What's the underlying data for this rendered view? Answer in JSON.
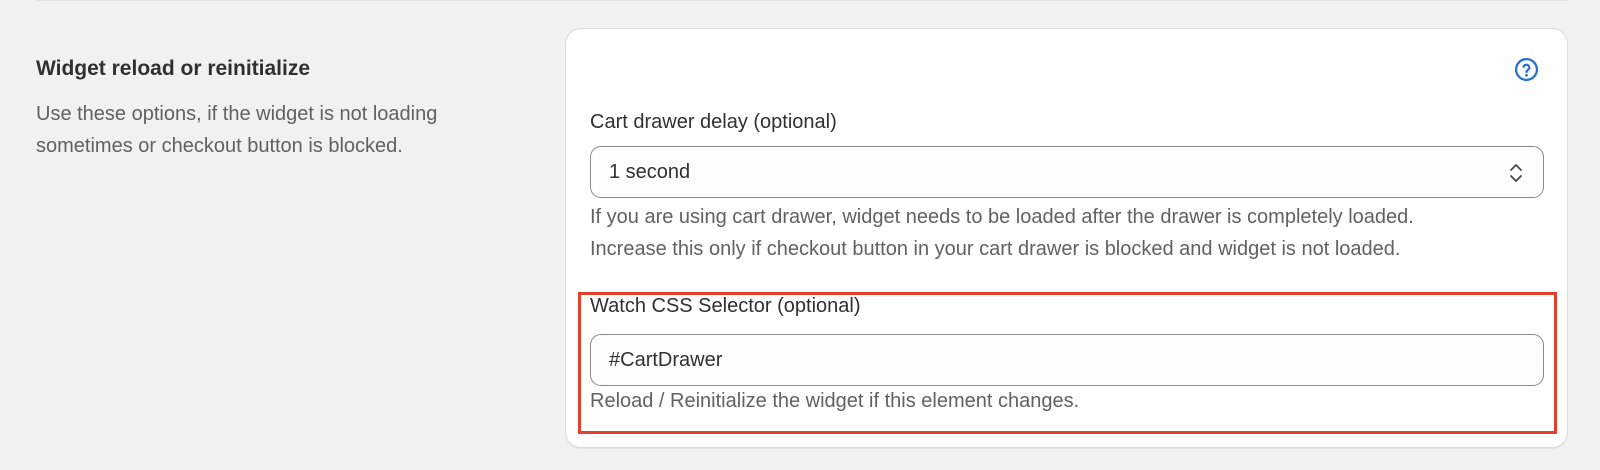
{
  "section": {
    "title": "Widget reload or reinitialize",
    "description": "Use these options, if the widget is not loading sometimes or checkout button is blocked."
  },
  "card": {
    "help_icon": "question-circle-icon",
    "cart_drawer_delay": {
      "label": "Cart drawer delay (optional)",
      "selected_value": "1 second",
      "chevron_icon": "select-chevron-icon",
      "help_line_1": "If you are using cart drawer, widget needs to be loaded after the drawer is completely loaded.",
      "help_line_2": "Increase this only if checkout button in your cart drawer is blocked and widget is not loaded."
    },
    "watch_selector": {
      "label": "Watch CSS Selector (optional)",
      "value": "#CartDrawer",
      "help": "Reload / Reinitialize the widget if this element changes."
    }
  },
  "colors": {
    "accent": "#2c6ecb",
    "highlight": "#e4402b",
    "background": "#f1f1f1",
    "card": "#ffffff"
  }
}
